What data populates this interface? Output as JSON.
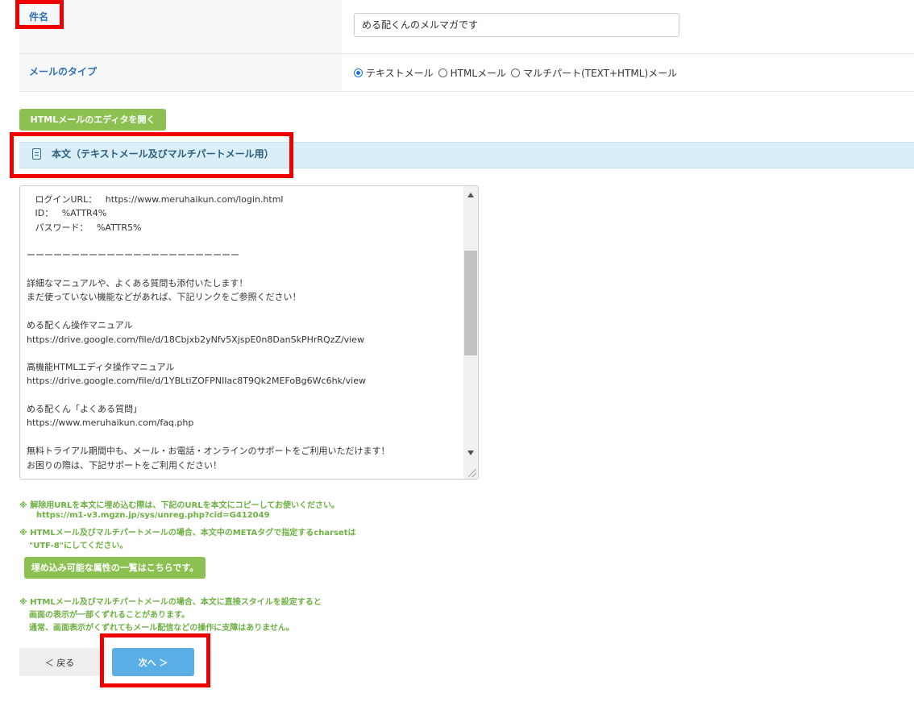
{
  "subject": {
    "label": "件名",
    "value": "める配くんのメルマガです"
  },
  "mail_type": {
    "label": "メールのタイプ",
    "options": [
      {
        "label": "テキストメール",
        "checked": true
      },
      {
        "label": "HTMLメール",
        "checked": false
      },
      {
        "label": "マルチパート(TEXT+HTML)メール",
        "checked": false
      }
    ]
  },
  "html_editor_button": "HTMLメールのエディタを開く",
  "body_section": {
    "title": "本文（テキストメール及びマルチパートメール用）",
    "icon": "document-icon",
    "lines": [
      "   ログインURL：   https://www.meruhaikun.com/login.html",
      "   ID：   %ATTR4%",
      "   パスワード：   %ATTR5%",
      "",
      "ーーーーーーーーーーーーーーーーーーーーーーーー",
      "",
      "詳細なマニュアルや、よくある質問も添付いたします！",
      "まだ使っていない機能などがあれば、下記リンクをご参照ください！",
      "",
      "める配くん操作マニュアル",
      "https://drive.google.com/file/d/18Cbjxb2yNfv5XjspE0n8DanSkPHrRQzZ/view",
      "",
      "高機能HTMLエディタ操作マニュアル",
      "https://drive.google.com/file/d/1YBLtiZOFPNIIac8T9Qk2MEFoBg6Wc6hk/view",
      "",
      "める配くん「よくある質問」",
      "https://www.meruhaikun.com/faq.php",
      "",
      "無料トライアル期間中も、メール・お電話・オンラインのサポートをご利用いただけます！",
      "お困りの際は、下記サポートをご利用ください！"
    ]
  },
  "notes": {
    "unsubscribe_1": "※ 解除用URLを本文に埋め込む際は、下記のURLを本文にコピーしてお使いください。",
    "unsubscribe_url": "https://m1-v3.mgzn.jp/sys/unreg.php?cid=G412049",
    "charset_1": "※ HTMLメール及びマルチパートメールの場合、本文中のMETAタグで指定するcharsetは",
    "charset_2": "\"UTF-8\"にしてください。",
    "attributes_button": "埋め込み可能な属性の一覧はこちらです。",
    "style_1": "※ HTMLメール及びマルチパートメールの場合、本文に直接スタイルを設定すると",
    "style_2": "画面の表示が一部くずれることがあります。",
    "style_3": "通常、画面表示がくずれてもメール配信などの操作に支障はありません。"
  },
  "nav": {
    "back": "＜  戻る",
    "next": "次へ  ＞"
  },
  "colors": {
    "accent_blue": "#2e72b5",
    "green": "#8cc152",
    "next_button": "#5aaee6",
    "highlight_red": "#ee0000"
  }
}
